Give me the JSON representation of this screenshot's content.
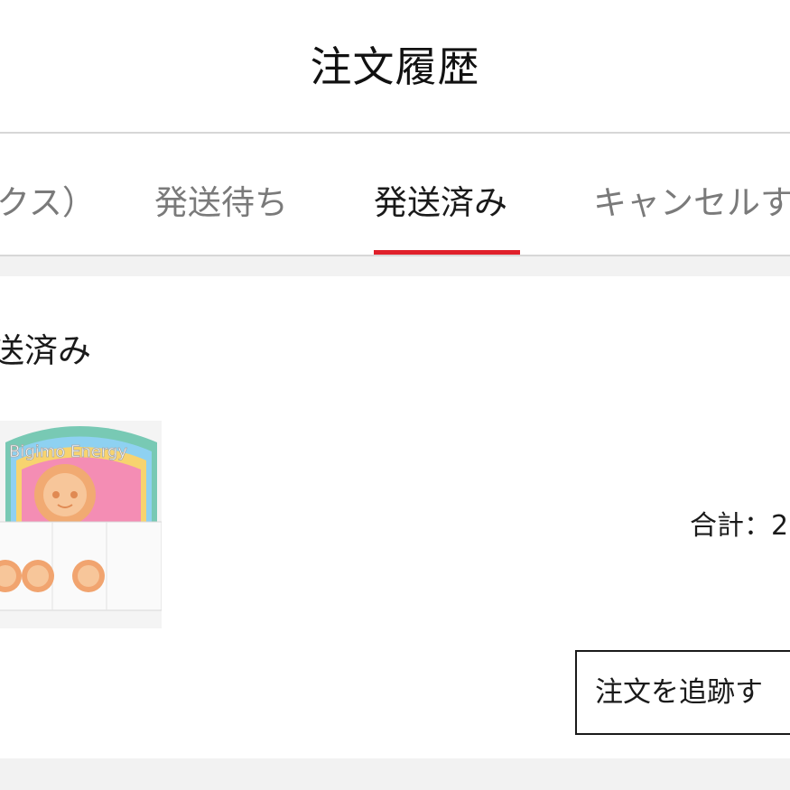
{
  "header": {
    "title": "注文履歴"
  },
  "tabs": [
    {
      "label": "クス）",
      "active": false
    },
    {
      "label": "発送待ち",
      "active": false
    },
    {
      "label": "発送済み",
      "active": true
    },
    {
      "label": "キャンセルす",
      "active": false
    }
  ],
  "order": {
    "status": "送済み",
    "total_label": "合計：2",
    "track_button_label": "注文を追跡す",
    "product_image": {
      "brand_text": "Bigimo Energy",
      "description": "boxed figure set"
    }
  },
  "colors": {
    "accent": "#e0202b",
    "divider": "#d7d7d7",
    "background_gap": "#f2f2f2",
    "active_text": "#1a1a1a",
    "inactive_text": "#7a7a7a"
  },
  "icons": {
    "product_image": "product-image"
  }
}
